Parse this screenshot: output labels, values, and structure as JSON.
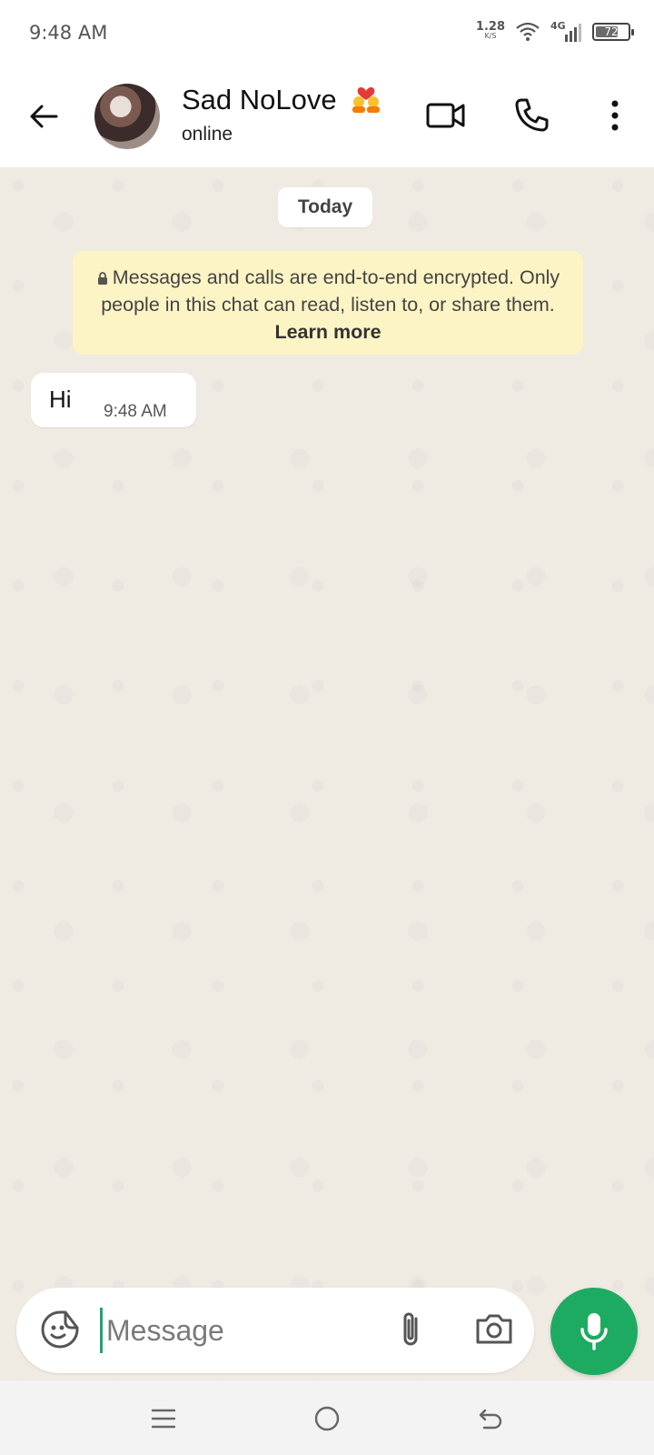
{
  "status_bar": {
    "time": "9:48 AM",
    "net_speed_value": "1.28",
    "net_speed_unit": "K/S",
    "network_type": "4G",
    "battery_level": "72",
    "battery_fraction": 0.72
  },
  "header": {
    "contact_name": "Sad NoLove",
    "contact_status": "online",
    "icons": {
      "back": "arrow-left",
      "video_call": "video-camera",
      "voice_call": "phone",
      "menu": "more-vertical"
    }
  },
  "chat": {
    "date_chip": "Today",
    "encryption_notice": {
      "text": "Messages and calls are end-to-end encrypted. Only people in this chat can read, listen to, or share them.",
      "link": "Learn more"
    },
    "messages": [
      {
        "text": "Hi",
        "time": "9:48 AM",
        "direction": "incoming"
      }
    ]
  },
  "composer": {
    "placeholder": "Message",
    "value": ""
  },
  "colors": {
    "accent_green": "#1dab61",
    "chat_bg": "#efeae2",
    "banner_bg": "#fdf4c5"
  }
}
